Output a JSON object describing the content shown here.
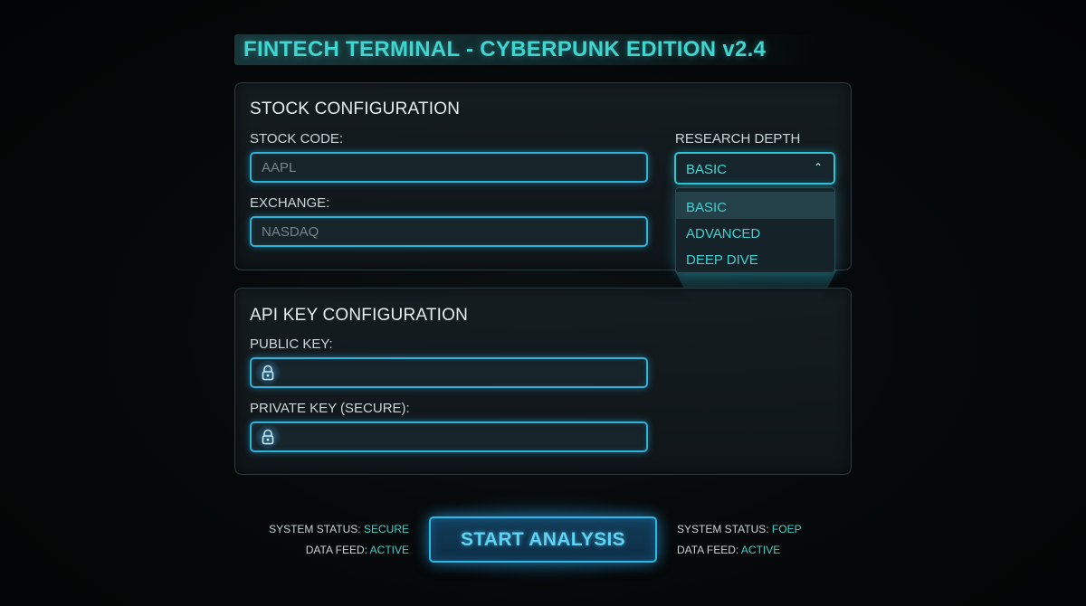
{
  "header": {
    "title": "FINTECH TERMINAL - CYBERPUNK EDITION v2.4"
  },
  "stock_panel": {
    "title": "STOCK CONFIGURATION",
    "stock_code_label": "STOCK CODE:",
    "stock_code_placeholder": "AAPL",
    "exchange_label": "EXCHANGE:",
    "exchange_placeholder": "NASDAQ",
    "research_depth_label": "RESEARCH DEPTH",
    "research_depth_selected": "BASIC",
    "research_depth_options": [
      "BASIC",
      "ADVANCED",
      "DEEP DIVE"
    ]
  },
  "api_panel": {
    "title": "API KEY CONFIGURATION",
    "public_key_label": "PUBLIC KEY:",
    "private_key_label": "PRIVATE KEY (SECURE):"
  },
  "actions": {
    "start_label": "START ANALYSIS"
  },
  "status_left": {
    "system_label": "SYSTEM STATUS:",
    "system_value": "SECURE",
    "feed_label": "DATA FEED:",
    "feed_value": "ACTIVE"
  },
  "status_right": {
    "system_label": "SYSTEM STATUS:",
    "system_value": "FOEP",
    "feed_label": "DATA FEED:",
    "feed_value": "ACTIVE"
  },
  "colors": {
    "accent_cyan": "#3fd6d2",
    "input_border": "#2fb2d8",
    "button_border": "#2eb8ea",
    "background": "#040607"
  },
  "icons": {
    "lock": "lock-icon",
    "caret": "chevron-up-icon"
  }
}
